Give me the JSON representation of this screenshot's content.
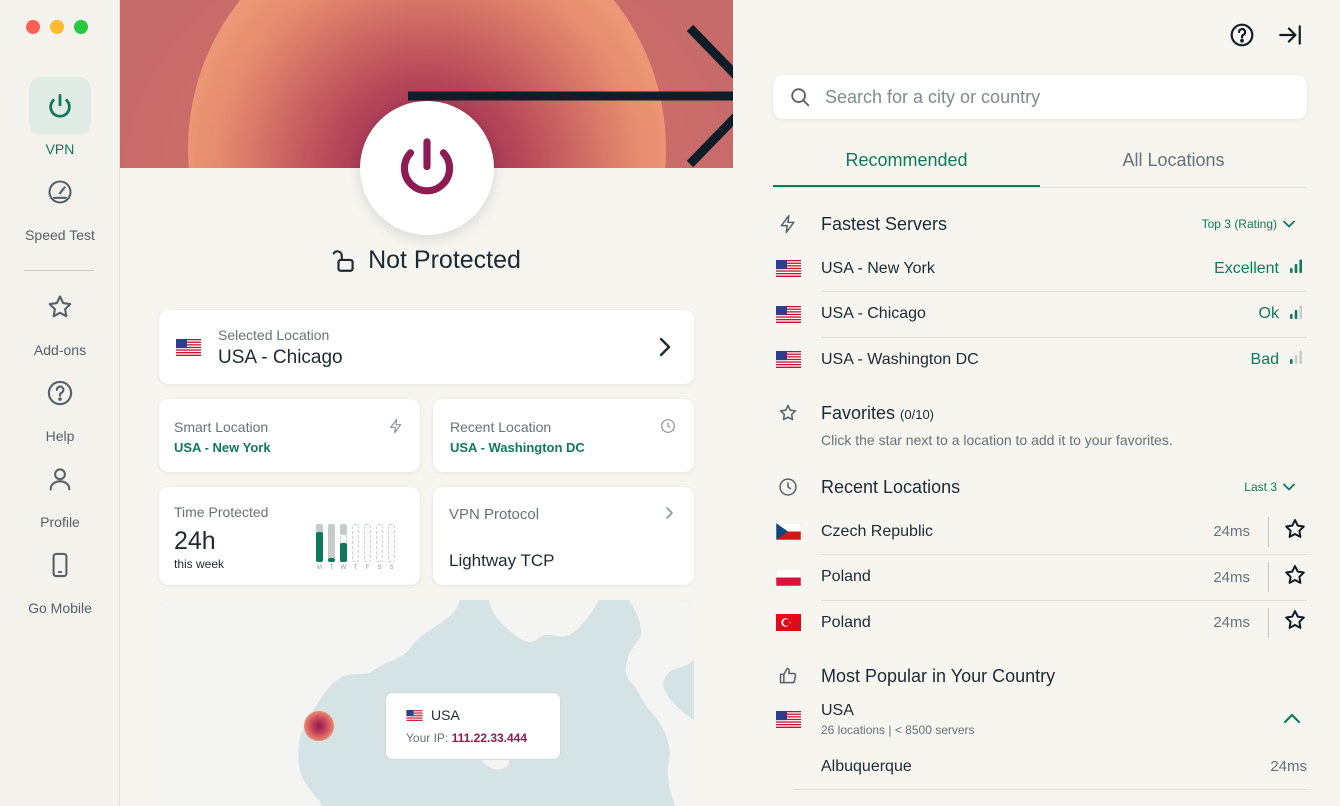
{
  "sidebar": {
    "items": [
      {
        "label": "VPN"
      },
      {
        "label": "Speed Test"
      },
      {
        "label": "Add-ons"
      },
      {
        "label": "Help"
      },
      {
        "label": "Profile"
      },
      {
        "label": "Go Mobile"
      }
    ]
  },
  "status": {
    "text": "Not Protected"
  },
  "selected_location": {
    "label": "Selected Location",
    "value": "USA - Chicago"
  },
  "smart_location": {
    "label": "Smart Location",
    "value": "USA - New York"
  },
  "recent_location": {
    "label": "Recent Location",
    "value": "USA - Washington DC"
  },
  "time_protected": {
    "label": "Time Protected",
    "value": "24h",
    "sub": "this week",
    "days": [
      "M",
      "T",
      "W",
      "T",
      "F",
      "S",
      "S"
    ],
    "fill_fraction": [
      0.8,
      0.1,
      0.5,
      0,
      0,
      0,
      0
    ],
    "top_fraction": [
      0.2,
      0.9,
      0.3,
      0,
      0,
      0,
      0
    ]
  },
  "vpn_protocol": {
    "label": "VPN Protocol",
    "value": "Lightway TCP"
  },
  "map": {
    "country": "USA",
    "ip_label": "Your IP:",
    "ip": "111.22.33.444"
  },
  "search": {
    "placeholder": "Search for a city or country"
  },
  "tabs": [
    {
      "label": "Recommended"
    },
    {
      "label": "All Locations"
    }
  ],
  "fastest": {
    "title": "Fastest Servers",
    "filter": "Top 3 (Rating)",
    "rows": [
      {
        "name": "USA - New York",
        "quality": "Excellent",
        "level": 3
      },
      {
        "name": "USA - Chicago",
        "quality": "Ok",
        "level": 2
      },
      {
        "name": "USA - Washington DC",
        "quality": "Bad",
        "level": 1
      }
    ]
  },
  "favorites": {
    "title": "Favorites",
    "count": "(0/10)",
    "hint": "Click the star next to a location to add it to your favorites."
  },
  "recent": {
    "title": "Recent Locations",
    "filter": "Last 3",
    "rows": [
      {
        "name": "Czech Republic",
        "ping": "24ms",
        "flag": "cz"
      },
      {
        "name": "Poland",
        "ping": "24ms",
        "flag": "pl"
      },
      {
        "name": "Poland",
        "ping": "24ms",
        "flag": "tr"
      }
    ]
  },
  "popular": {
    "title": "Most Popular in Your Country",
    "country": "USA",
    "country_sub": "26 locations | < 8500 servers",
    "city": "Albuquerque",
    "city_ping": "24ms"
  },
  "colors": {
    "accent": "#0e7a5a",
    "power": "#8c1c52",
    "ip": "#8c1c52"
  }
}
